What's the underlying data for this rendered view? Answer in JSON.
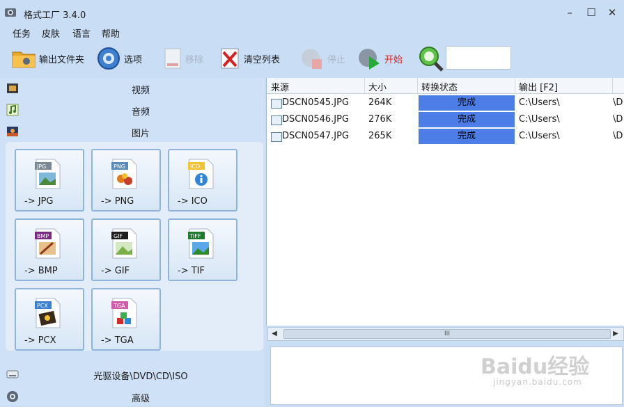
{
  "window": {
    "title": "格式工厂 3.4.0"
  },
  "menu": [
    "任务",
    "皮肤",
    "语言",
    "帮助"
  ],
  "toolbar": {
    "output_folder": "输出文件夹",
    "options": "选项",
    "remove": "移除",
    "clear_list": "清空列表",
    "stop": "停止",
    "start": "开始"
  },
  "categories": {
    "video": "视频",
    "audio": "音频",
    "image": "图片",
    "dvd": "光驱设备\\DVD\\CD\\ISO",
    "advanced": "高级"
  },
  "tiles": [
    {
      "badge": "JPG",
      "label": "-> JPG",
      "badge_color": "#7a8896"
    },
    {
      "badge": "PNG",
      "label": "-> PNG",
      "badge_color": "#5a8ab8"
    },
    {
      "badge": "ICO",
      "label": "-> ICO",
      "badge_color": "#f2c230"
    },
    {
      "badge": "BMP",
      "label": "-> BMP",
      "badge_color": "#7a2a80"
    },
    {
      "badge": "GIF",
      "label": "-> GIF",
      "badge_color": "#1e1e1e"
    },
    {
      "badge": "TIFF",
      "label": "-> TIF",
      "badge_color": "#1f7a2e"
    },
    {
      "badge": "PCX",
      "label": "-> PCX",
      "badge_color": "#3a7fd0"
    },
    {
      "badge": "TGA",
      "label": "-> TGA",
      "badge_color": "#d05aa8"
    }
  ],
  "table": {
    "headers": {
      "source": "来源",
      "size": "大小",
      "status": "转换状态",
      "output": "输出 [F2]"
    },
    "rows": [
      {
        "source": "DSCN0545.JPG",
        "size": "264K",
        "status": "完成",
        "output": "C:\\Users\\",
        "output_tail": "\\D"
      },
      {
        "source": "DSCN0546.JPG",
        "size": "276K",
        "status": "完成",
        "output": "C:\\Users\\",
        "output_tail": "\\D"
      },
      {
        "source": "DSCN0547.JPG",
        "size": "265K",
        "status": "完成",
        "output": "C:\\Users\\",
        "output_tail": "\\D"
      }
    ]
  },
  "scrollbar": {
    "thumb_grip": "III"
  },
  "watermark": {
    "main": "Baidu经验",
    "sub": "jingyan.baidu.com"
  },
  "colors": {
    "accent": "#4d7de6",
    "window_bg": "#c9def5",
    "start_label": "#e02020"
  }
}
